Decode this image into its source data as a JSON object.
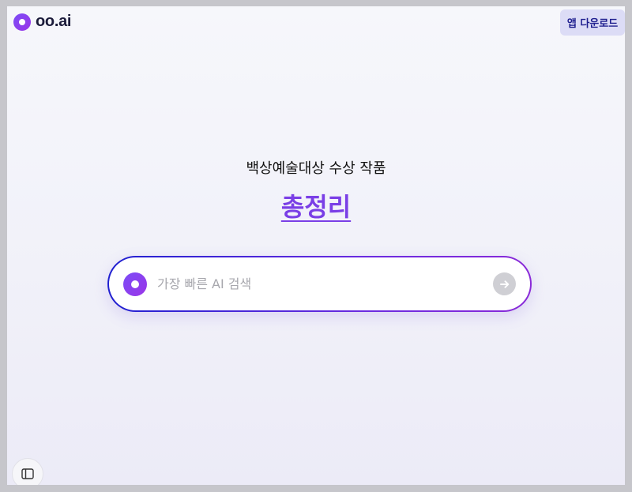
{
  "header": {
    "logo_text": "oo.ai",
    "logo_icon": "oo-logo-icon",
    "app_download_label": "앱 다운로드"
  },
  "hero": {
    "subtitle": "백상예술대상 수상 작품",
    "headline_link": "총정리"
  },
  "search": {
    "placeholder": "가장 빠른 AI 검색",
    "value": "",
    "logo_icon": "oo-logo-icon",
    "submit_icon": "arrow-right-icon"
  },
  "footer": {
    "sidebar_toggle_icon": "sidebar-panel-icon"
  },
  "colors": {
    "brand_purple": "#7a3fe6",
    "search_border_start": "#2020d0",
    "search_border_end": "#8a2ad8",
    "app_button_bg": "#dcdcf6",
    "app_button_text": "#1f1f8f"
  }
}
